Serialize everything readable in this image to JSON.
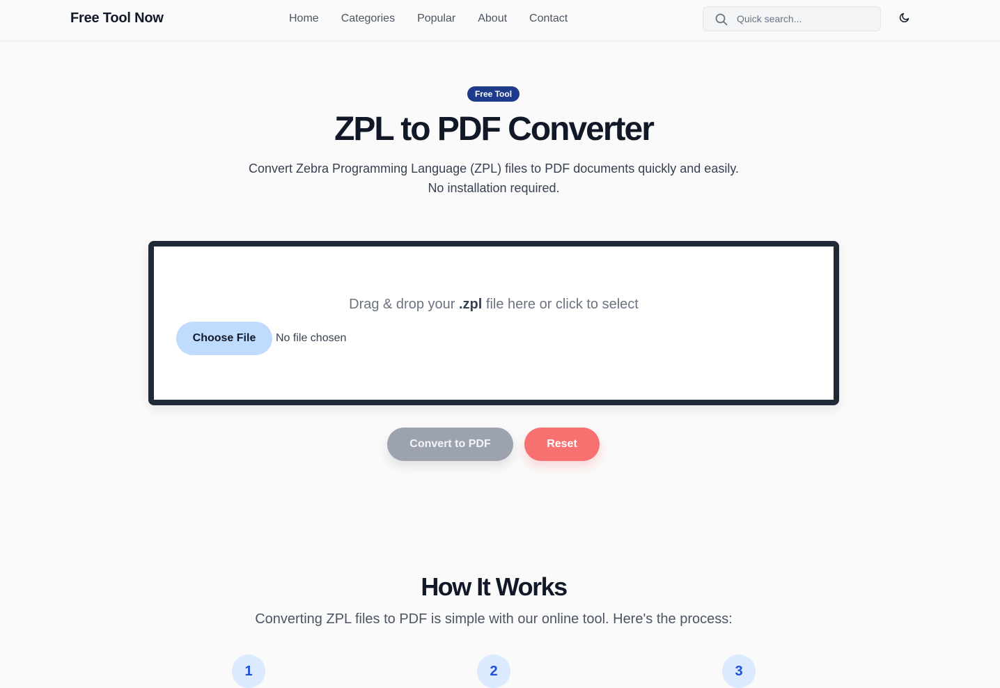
{
  "header": {
    "brand": "Free Tool Now",
    "nav": [
      "Home",
      "Categories",
      "Popular",
      "About",
      "Contact"
    ],
    "search_placeholder": "Quick search...",
    "icons": {
      "search": "search-icon",
      "theme": "moon-icon"
    }
  },
  "hero": {
    "badge": "Free Tool",
    "title": "ZPL to PDF Converter",
    "subtitle_line1": "Convert Zebra Programming Language (ZPL) files to PDF documents quickly and easily.",
    "subtitle_line2": "No installation required."
  },
  "upload": {
    "drop_prefix": "Drag & drop your ",
    "drop_ext": ".zpl",
    "drop_suffix": " file here or click to select",
    "choose_label": "Choose File",
    "file_status": "No file chosen"
  },
  "actions": {
    "convert_label": "Convert to PDF",
    "reset_label": "Reset"
  },
  "how": {
    "title": "How It Works",
    "subtitle": "Converting ZPL files to PDF is simple with our online tool. Here's the process:",
    "steps": [
      "1",
      "2",
      "3"
    ]
  },
  "colors": {
    "badge": "#1e3a8a",
    "choose": "#bfdbfe",
    "convert_disabled": "#9ca3af",
    "reset": "#f87171",
    "step_bg": "#dbeafe",
    "step_text": "#1d4ed8"
  }
}
